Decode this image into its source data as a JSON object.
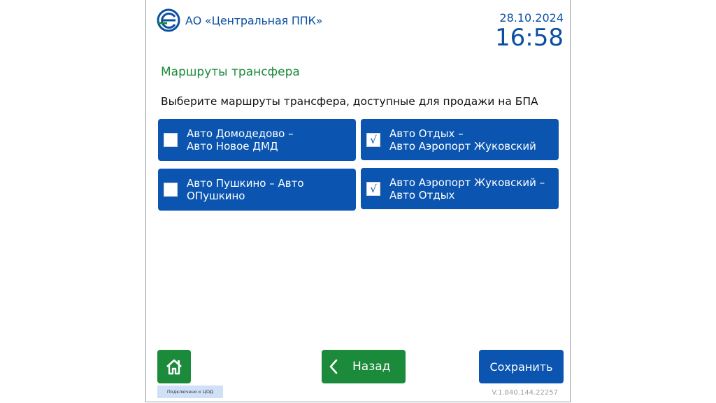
{
  "header": {
    "company_name": "АО «Центральная ППК»",
    "date": "28.10.2024",
    "time": "16:58"
  },
  "page": {
    "title": "Маршруты трансфера",
    "instruction": "Выберите маршруты трансфера, доступные для продажи на БПА"
  },
  "routes": [
    {
      "line1": "Авто Домодедово –",
      "line2": "Авто Новое ДМД",
      "checked": false,
      "mark": ""
    },
    {
      "line1": "Авто Отдых –",
      "line2": "Авто Аэропорт Жуковский",
      "checked": true,
      "mark": "√"
    },
    {
      "line1": "Авто Пушкино – Авто",
      "line2": "ОПушкино",
      "checked": false,
      "mark": ""
    },
    {
      "line1": "Авто Аэропорт Жуковский –",
      "line2": "Авто Отдых",
      "checked": true,
      "mark": "√"
    }
  ],
  "footer": {
    "home_icon": "home-icon",
    "status_text": "Подключено к ЦОД",
    "back_label": "Назад",
    "back_icon": "chevron-left-icon",
    "save_label": "Сохранить",
    "version": "V.1.840.144.22257"
  },
  "colors": {
    "brand_blue": "#0b55b0",
    "brand_green": "#1b8a3a",
    "text_blue": "#0b4fa1"
  }
}
